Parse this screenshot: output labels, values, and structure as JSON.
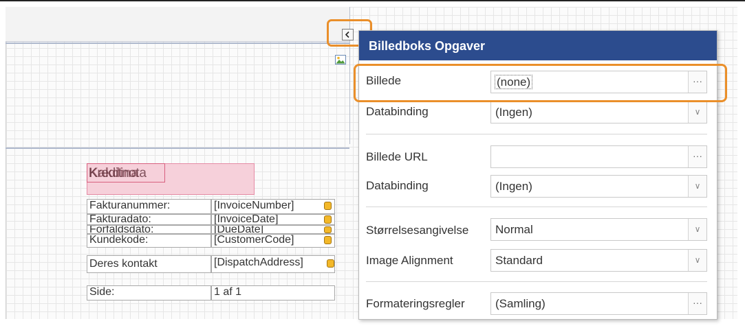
{
  "report": {
    "title_overlap_a": "Kakdina",
    "title_overlap_b": "Kreditnota",
    "fields": [
      {
        "label": "Fakturanummer:",
        "value": "[InvoiceNumber]"
      },
      {
        "label": "Fakturadato:",
        "value": "[InvoiceDate]"
      },
      {
        "label": "Forfaldsdato:",
        "value": "[DueDate]"
      },
      {
        "label": "Kundekode:",
        "value": "[CustomerCode]"
      },
      {
        "label": "Deres kontakt",
        "value": "[DispatchAddress]"
      }
    ],
    "page_label": "Side:",
    "page_value": "1 af 1"
  },
  "smart_tag_icon": "chevron-left-icon",
  "panel": {
    "title": "Billedboks Opgaver",
    "rows": [
      {
        "label": "Billede",
        "value": "(none)",
        "button": "···"
      },
      {
        "label": "Databinding",
        "value": "(Ingen)"
      },
      {
        "label": "Billede URL",
        "value": "",
        "button": "···"
      },
      {
        "label": "Databinding",
        "value": "(Ingen)"
      },
      {
        "label": "Størrelsesangivelse",
        "value": "Normal"
      },
      {
        "label": "Image Alignment",
        "value": "Standard"
      },
      {
        "label": "Formateringsregler",
        "value": "(Samling)",
        "button": "···"
      }
    ]
  },
  "colors": {
    "panel_header": "#2c4c8e",
    "highlight": "#ea8f2a",
    "title_box": "#f6d0da"
  }
}
